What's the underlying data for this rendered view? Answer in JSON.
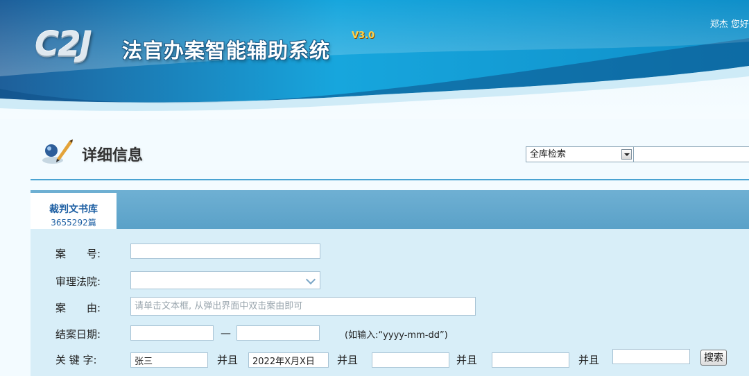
{
  "header": {
    "logo_text": "C2J",
    "system_title": "法官办案智能辅助系统",
    "version": "V3.0",
    "greeting": "郑杰 您好,"
  },
  "section": {
    "title": "详细信息"
  },
  "global_search": {
    "scope_selected": "全库检索",
    "query_value": ""
  },
  "tab": {
    "name": "裁判文书库",
    "count": "3655292篇"
  },
  "form": {
    "case_no_label": "案　　号:",
    "court_label": "审理法院:",
    "cause_label": "案　　由:",
    "cause_placeholder": "请单击文本框, 从弹出界面中双击案由即可",
    "date_label": "结案日期:",
    "date_separator": "—",
    "date_hint": "(如输入:“yyyy-mm-dd”)",
    "keyword_label": "关 键 字:",
    "keyword_values": [
      "张三",
      "2022年X月X日",
      "",
      "",
      ""
    ],
    "and_label": "并且",
    "search_label": "搜索"
  },
  "colors": {
    "banner_blue": "#1aa3dc",
    "tab_bar": "#5aa1c8",
    "tab_text": "#1d5fa3",
    "form_bg": "#d8eef8"
  }
}
